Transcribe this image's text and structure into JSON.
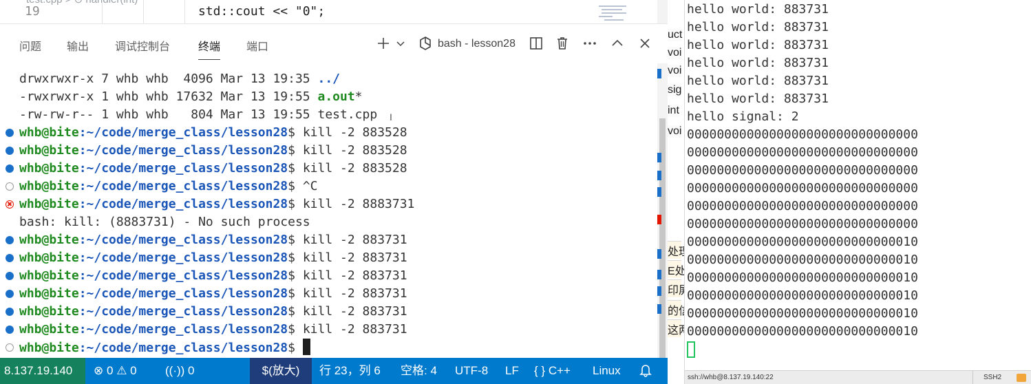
{
  "editor": {
    "ghost_text": "test.cpp  >  ⊙ handler(int)",
    "line_number": "19",
    "code_line": "std::cout << \"0\";"
  },
  "panel": {
    "tabs": [
      "问题",
      "输出",
      "调试控制台",
      "终端",
      "端口"
    ],
    "active_tab": "终端",
    "terminal_name": "bash - lesson28"
  },
  "terminal": {
    "lines": [
      {
        "kind": "plain",
        "text": "drwxrwxr-x 7 whb whb  4096 Mar 13 19:35 ",
        "suffix": "../",
        "suffix_kind": "dir"
      },
      {
        "kind": "plain",
        "text": "-rwxrwxr-x 1 whb whb 17632 Mar 13 19:55 ",
        "suffix": "a.out",
        "suffix_kind": "exe",
        "tail": "*"
      },
      {
        "kind": "plain",
        "text": "-rw-rw-r-- 1 whb whb   804 Mar 13 19:55 test.cpp"
      },
      {
        "kind": "prompt",
        "status": "blue",
        "cmd": "kill -2 883528"
      },
      {
        "kind": "prompt",
        "status": "blue",
        "cmd": "kill -2 883528"
      },
      {
        "kind": "prompt",
        "status": "blue",
        "cmd": "kill -2 883528"
      },
      {
        "kind": "prompt",
        "status": "hollow",
        "cmd": "^C"
      },
      {
        "kind": "prompt",
        "status": "err",
        "cmd": "kill -2 8883731"
      },
      {
        "kind": "plain",
        "text": "bash: kill: (8883731) - No such process"
      },
      {
        "kind": "prompt",
        "status": "blue",
        "cmd": "kill -2 883731"
      },
      {
        "kind": "prompt",
        "status": "blue",
        "cmd": "kill -2 883731"
      },
      {
        "kind": "prompt",
        "status": "blue",
        "cmd": "kill -2 883731"
      },
      {
        "kind": "prompt",
        "status": "blue",
        "cmd": "kill -2 883731"
      },
      {
        "kind": "prompt",
        "status": "blue",
        "cmd": "kill -2 883731"
      },
      {
        "kind": "prompt",
        "status": "blue",
        "cmd": "kill -2 883731"
      },
      {
        "kind": "prompt",
        "status": "hollow",
        "cmd": "",
        "cursor": true
      }
    ],
    "prompt_user": "whb@bite",
    "prompt_path": ":~/code/merge_class/lesson28",
    "prompt_sign": "$ "
  },
  "statusbar": {
    "remote": "8.137.19.140",
    "errors": "0",
    "warnings": "0",
    "ports": "0",
    "mode": "$(放大)",
    "position": "行 23，列 6",
    "indent": "空格: 4",
    "encoding": "UTF-8",
    "eol": "LF",
    "language": "C++",
    "platform": "Linux"
  },
  "midstrip": {
    "fragments": [
      "uct",
      "voi",
      "voi",
      "sig",
      "int",
      "voi"
    ],
    "cn": [
      "处理",
      "E处",
      "印屏",
      "的信",
      "这两"
    ]
  },
  "ssh": {
    "output": [
      "hello world: 883731",
      "hello world: 883731",
      "hello world: 883731",
      "hello world: 883731",
      "hello world: 883731",
      "hello world: 883731",
      "hello signal: 2",
      "0000000000000000000000000000000",
      "0000000000000000000000000000000",
      "0000000000000000000000000000000",
      "0000000000000000000000000000000",
      "0000000000000000000000000000000",
      "0000000000000000000000000000000",
      "0000000000000000000000000000010",
      "0000000000000000000000000000010",
      "0000000000000000000000000000010",
      "0000000000000000000000000000010",
      "0000000000000000000000000000010",
      "0000000000000000000000000000010"
    ],
    "status_left": "ssh://whb@8.137.19.140:22",
    "status_right": "SSH2"
  },
  "colors": {
    "statusbar": "#007acc",
    "remote": "#16825d",
    "prompt_user": "#1f8a1f",
    "prompt_path": "#1a55b8",
    "status_dot": "#1a6fc9",
    "error": "#e51400"
  },
  "icons": [
    "plus-icon",
    "chevron-down-icon",
    "terminal-profile-icon",
    "split-icon",
    "trash-icon",
    "more-icon",
    "chevron-up-icon",
    "close-icon",
    "error-icon",
    "warning-icon",
    "broadcast-icon",
    "braces-icon",
    "bell-icon"
  ]
}
